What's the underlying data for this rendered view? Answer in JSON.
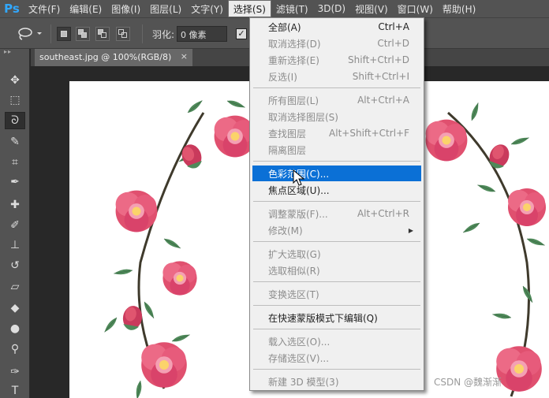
{
  "app": {
    "logo": "Ps",
    "accent": "#31a8ff"
  },
  "menubar": {
    "items": [
      {
        "label": "文件(F)"
      },
      {
        "label": "编辑(E)"
      },
      {
        "label": "图像(I)"
      },
      {
        "label": "图层(L)"
      },
      {
        "label": "文字(Y)"
      },
      {
        "label": "选择(S)"
      },
      {
        "label": "滤镜(T)"
      },
      {
        "label": "3D(D)"
      },
      {
        "label": "视图(V)"
      },
      {
        "label": "窗口(W)"
      },
      {
        "label": "帮助(H)"
      }
    ]
  },
  "options": {
    "tool_icon": "lasso-icon",
    "feather_label": "羽化:",
    "feather_value": "0 像素",
    "antialias_checked": "✓"
  },
  "document": {
    "tab_title": "southeast.jpg @ 100%(RGB/8)",
    "close": "×"
  },
  "toolbar": {
    "grip": "▸▸",
    "tools": [
      {
        "name": "move-tool",
        "glyph": "✥"
      },
      {
        "name": "marquee-tool",
        "glyph": "⬚"
      },
      {
        "name": "lasso-tool",
        "glyph": "ᘐ"
      },
      {
        "name": "quick-selection-tool",
        "glyph": "✎"
      },
      {
        "name": "crop-tool",
        "glyph": "⌗"
      },
      {
        "name": "eyedropper-tool",
        "glyph": "✒"
      },
      {
        "name": "healing-brush-tool",
        "glyph": "✚"
      },
      {
        "name": "brush-tool",
        "glyph": "✐"
      },
      {
        "name": "clone-stamp-tool",
        "glyph": "⊥"
      },
      {
        "name": "history-brush-tool",
        "glyph": "↺"
      },
      {
        "name": "eraser-tool",
        "glyph": "▱"
      },
      {
        "name": "paint-bucket-tool",
        "glyph": "◆"
      },
      {
        "name": "blur-tool",
        "glyph": "●"
      },
      {
        "name": "dodge-tool",
        "glyph": "⚲"
      },
      {
        "name": "pen-tool",
        "glyph": "✑"
      },
      {
        "name": "type-tool",
        "glyph": "T"
      }
    ]
  },
  "select_menu": {
    "items": [
      {
        "label": "全部(A)",
        "shortcut": "Ctrl+A",
        "enabled": true
      },
      {
        "label": "取消选择(D)",
        "shortcut": "Ctrl+D",
        "enabled": false
      },
      {
        "label": "重新选择(E)",
        "shortcut": "Shift+Ctrl+D",
        "enabled": false
      },
      {
        "label": "反选(I)",
        "shortcut": "Shift+Ctrl+I",
        "enabled": false
      },
      {
        "label": "所有图层(L)",
        "shortcut": "Alt+Ctrl+A",
        "enabled": false
      },
      {
        "label": "取消选择图层(S)",
        "shortcut": "",
        "enabled": false
      },
      {
        "label": "查找图层",
        "shortcut": "Alt+Shift+Ctrl+F",
        "enabled": false
      },
      {
        "label": "隔离图层",
        "shortcut": "",
        "enabled": false
      },
      {
        "label": "色彩范围(C)...",
        "shortcut": "",
        "enabled": true,
        "highlighted": true
      },
      {
        "label": "焦点区域(U)...",
        "shortcut": "",
        "enabled": true
      },
      {
        "label": "调整蒙版(F)...",
        "shortcut": "Alt+Ctrl+R",
        "enabled": false
      },
      {
        "label": "修改(M)",
        "shortcut": "",
        "enabled": false,
        "submenu": "▶"
      },
      {
        "label": "扩大选取(G)",
        "shortcut": "",
        "enabled": false
      },
      {
        "label": "选取相似(R)",
        "shortcut": "",
        "enabled": false
      },
      {
        "label": "变换选区(T)",
        "shortcut": "",
        "enabled": false
      },
      {
        "label": "在快速蒙版模式下编辑(Q)",
        "shortcut": "",
        "enabled": true
      },
      {
        "label": "载入选区(O)...",
        "shortcut": "",
        "enabled": false
      },
      {
        "label": "存储选区(V)...",
        "shortcut": "",
        "enabled": false
      },
      {
        "label": "新建 3D 模型(3)",
        "shortcut": "",
        "enabled": false
      }
    ],
    "highlight_color": "#0b70d6"
  },
  "watermark": "CSDN @魏渐渐"
}
